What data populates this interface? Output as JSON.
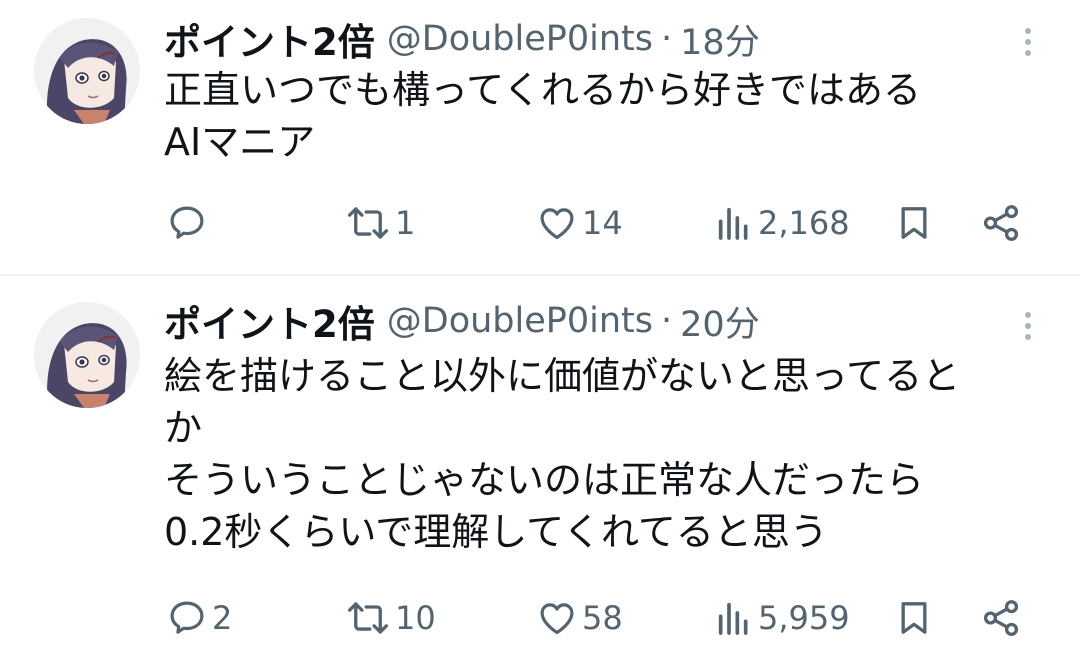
{
  "tweets": [
    {
      "author": {
        "name": "ポイント2倍",
        "handle": "@DoubleP0ints"
      },
      "separator": "·",
      "time": "18分",
      "lines": [
        "正直いつでも構ってくれるから好きではある",
        "AIマニア"
      ],
      "stats": {
        "replies": "",
        "retweets": "1",
        "likes": "14",
        "views": "2,168"
      }
    },
    {
      "author": {
        "name": "ポイント2倍",
        "handle": "@DoubleP0ints"
      },
      "separator": "·",
      "time": "20分",
      "lines": [
        "絵を描けること以外に価値がないと思ってると",
        "か",
        "そういうことじゃないのは正常な人だったら",
        "0.2秒くらいで理解してくれてると思う"
      ],
      "stats": {
        "replies": "2",
        "retweets": "10",
        "likes": "58",
        "views": "5,959"
      }
    }
  ],
  "icons": {
    "reply": "speech-bubble-icon",
    "retweet": "repost-arrows-icon",
    "like": "heart-outline-icon",
    "views": "bar-chart-icon",
    "bookmark": "bookmark-icon",
    "share": "share-nodes-icon",
    "more": "vertical-ellipsis-icon"
  },
  "colors": {
    "text": "#0f1419",
    "muted": "#536471",
    "divider": "#eff3f4",
    "avatar_hair": "#4b4666"
  }
}
